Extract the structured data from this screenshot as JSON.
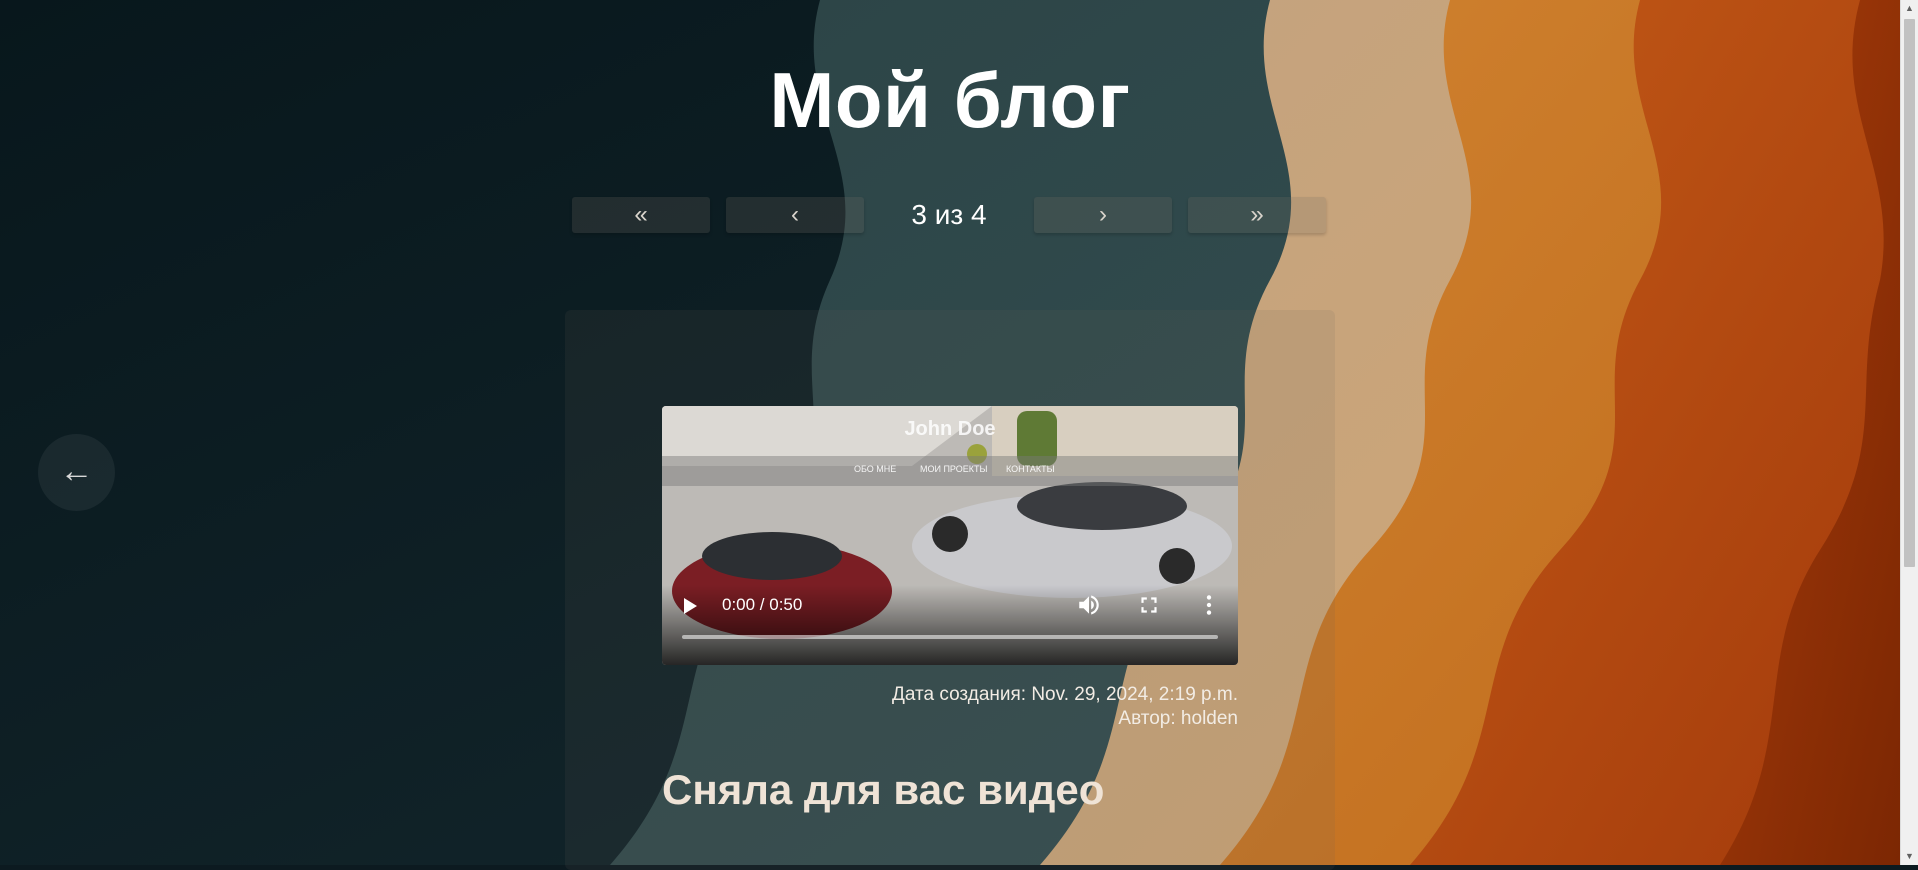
{
  "blog": {
    "title": "Мой блог"
  },
  "pagination": {
    "first": "«",
    "prev": "‹",
    "current": "3 из 4",
    "next": "›",
    "last": "»"
  },
  "nav": {
    "back_arrow": "←"
  },
  "video": {
    "time": "0:00 / 0:50",
    "progress": 0,
    "frame": {
      "site_title": "John Doe",
      "nav_items": [
        "ОБО МНЕ",
        "МОИ ПРОЕКТЫ",
        "КОНТАКТЫ"
      ]
    }
  },
  "post": {
    "created": "Дата создания: Nov. 29, 2024, 2:19 p.m.",
    "author": "Автор: holden",
    "heading": "Сняла для вас видео"
  },
  "icons": [
    "play-icon",
    "volume-icon",
    "fullscreen-icon",
    "more-options-icon",
    "back-arrow-icon"
  ],
  "colors": {
    "title": "#ffffff",
    "text": "#f2ece4"
  }
}
